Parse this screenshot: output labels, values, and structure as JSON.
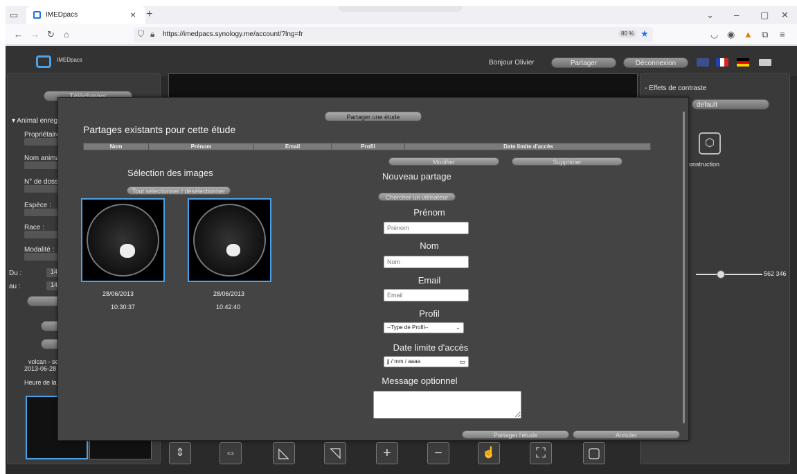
{
  "browser": {
    "tab_title": "IMEDpacs",
    "tab_close": "×",
    "tab_new": "+",
    "url": "https://imedpacs.synology.me/account/?lng=fr",
    "zoom": "80 %",
    "window_controls": [
      "⌄",
      "–",
      "▢",
      "✕"
    ]
  },
  "app": {
    "brand": "IMEDpacs",
    "greeting": "Bonjour Olivier",
    "share_button": "Partager",
    "logout_button": "Déconnexion",
    "left_panel": {
      "download_button": "Télécharger",
      "section_header": "▾ Animal enreg",
      "labels": [
        "Propriétaire",
        "Nom anima",
        "N° de doss",
        "Espèce :",
        "Race :",
        "Modalité :"
      ],
      "du_label": "Du :",
      "au_label": "au :",
      "du_value": "14",
      "au_value": "14",
      "study_line1": "volcan - se",
      "study_line2": "2013-06-28",
      "time_label": "Heure de la"
    },
    "right_panel": {
      "contrast_label": "- Effets de contraste",
      "contrast_value": "default",
      "reconstruction_label": "onstruction",
      "slider_value": "562 346"
    }
  },
  "modal": {
    "share_study_button": "Partager une étude",
    "existing_title": "Partages existants pour cette étude",
    "table_headers": [
      "Nom",
      "Prénom",
      "Email",
      "Profil",
      "Date limite d'accès"
    ],
    "modify_button": "Modifier",
    "delete_button": "Supprimer",
    "images_title": "Sélection des images",
    "select_all_button": "Tout sélectionner / désélectionner",
    "thumbnails": [
      {
        "date": "28/06/2013",
        "time": "10:30:37"
      },
      {
        "date": "28/06/2013",
        "time": "10:42:40"
      }
    ],
    "new_share_title": "Nouveau partage",
    "search_user_button": "Chercher un utilisateur",
    "firstname_label": "Prénom",
    "firstname_placeholder": "Prénom",
    "name_label": "Nom",
    "name_placeholder": "Nom",
    "email_label": "Email",
    "email_placeholder": "Email",
    "profile_label": "Profil",
    "profile_selected": "--Type de Profil--",
    "date_label": "Date limite d'accès",
    "date_placeholder": "jj / mm / aaaa",
    "message_label": "Message optionnel",
    "submit_button": "Partager l'étude",
    "cancel_button": "Annuler"
  },
  "colors": {
    "accent": "#4aa3e8",
    "app_bg": "#2a2a2a",
    "modal_bg": "#444444"
  }
}
